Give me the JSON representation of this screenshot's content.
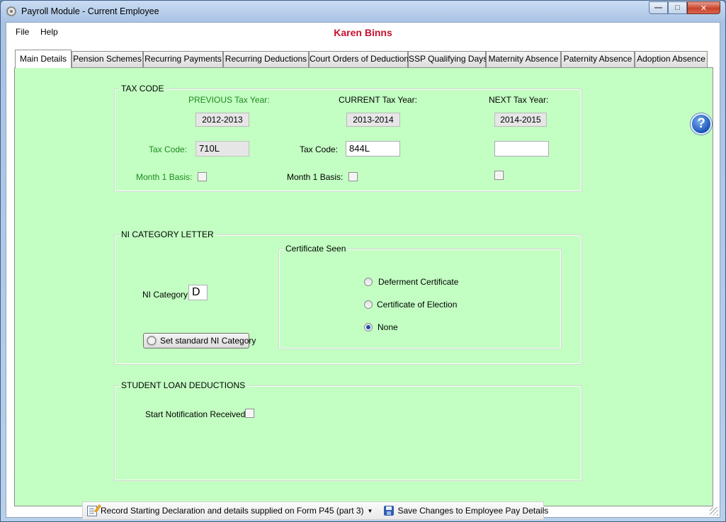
{
  "window": {
    "title": "Payroll Module - Current Employee"
  },
  "menu": {
    "file": "File",
    "help": "Help"
  },
  "employee_name": "Karen Binns",
  "tabs": [
    "Main Details",
    "Pension Schemes",
    "Recurring Payments",
    "Recurring Deductions",
    "Court Orders of Deduction",
    "SSP Qualifying Days",
    "Maternity Absence",
    "Paternity Absence",
    "Adoption Absence"
  ],
  "tax_code": {
    "legend": "TAX CODE",
    "previous_label": "PREVIOUS Tax Year:",
    "current_label": "CURRENT Tax Year:",
    "next_label": "NEXT Tax Year:",
    "previous_year": "2012-2013",
    "current_year": "2013-2014",
    "next_year": "2014-2015",
    "prev_tax_code_label": "Tax Code:",
    "cur_tax_code_label": "Tax Code:",
    "previous_code": "710L",
    "current_code": "844L",
    "next_code": "",
    "prev_month1_label": "Month 1 Basis:",
    "cur_month1_label": "Month 1 Basis:"
  },
  "ni": {
    "legend": "NI CATEGORY LETTER",
    "category_label": "NI Category:",
    "category_value": "D",
    "set_button": "Set standard NI Category",
    "certificate_legend": "Certificate Seen",
    "options": [
      "Deferment Certificate",
      "Certificate of Election",
      "None"
    ],
    "selected": "None"
  },
  "student_loan": {
    "legend": "STUDENT LOAN DEDUCTIONS",
    "start_label": "Start Notification Received:"
  },
  "toolbar": {
    "record_label": "Record Starting Declaration and details supplied on Form P45 (part 3)",
    "save_label": "Save Changes to Employee Pay Details"
  },
  "colors": {
    "tab_page_bg": "#c3ffc3",
    "employee_name": "#c8102e",
    "previous_year_text": "#1d8a1d"
  },
  "icons": [
    "settings-icon",
    "help-icon",
    "gear-icon",
    "document-edit-icon",
    "save-disk-icon",
    "minimize-icon",
    "maximize-icon",
    "close-icon"
  ]
}
